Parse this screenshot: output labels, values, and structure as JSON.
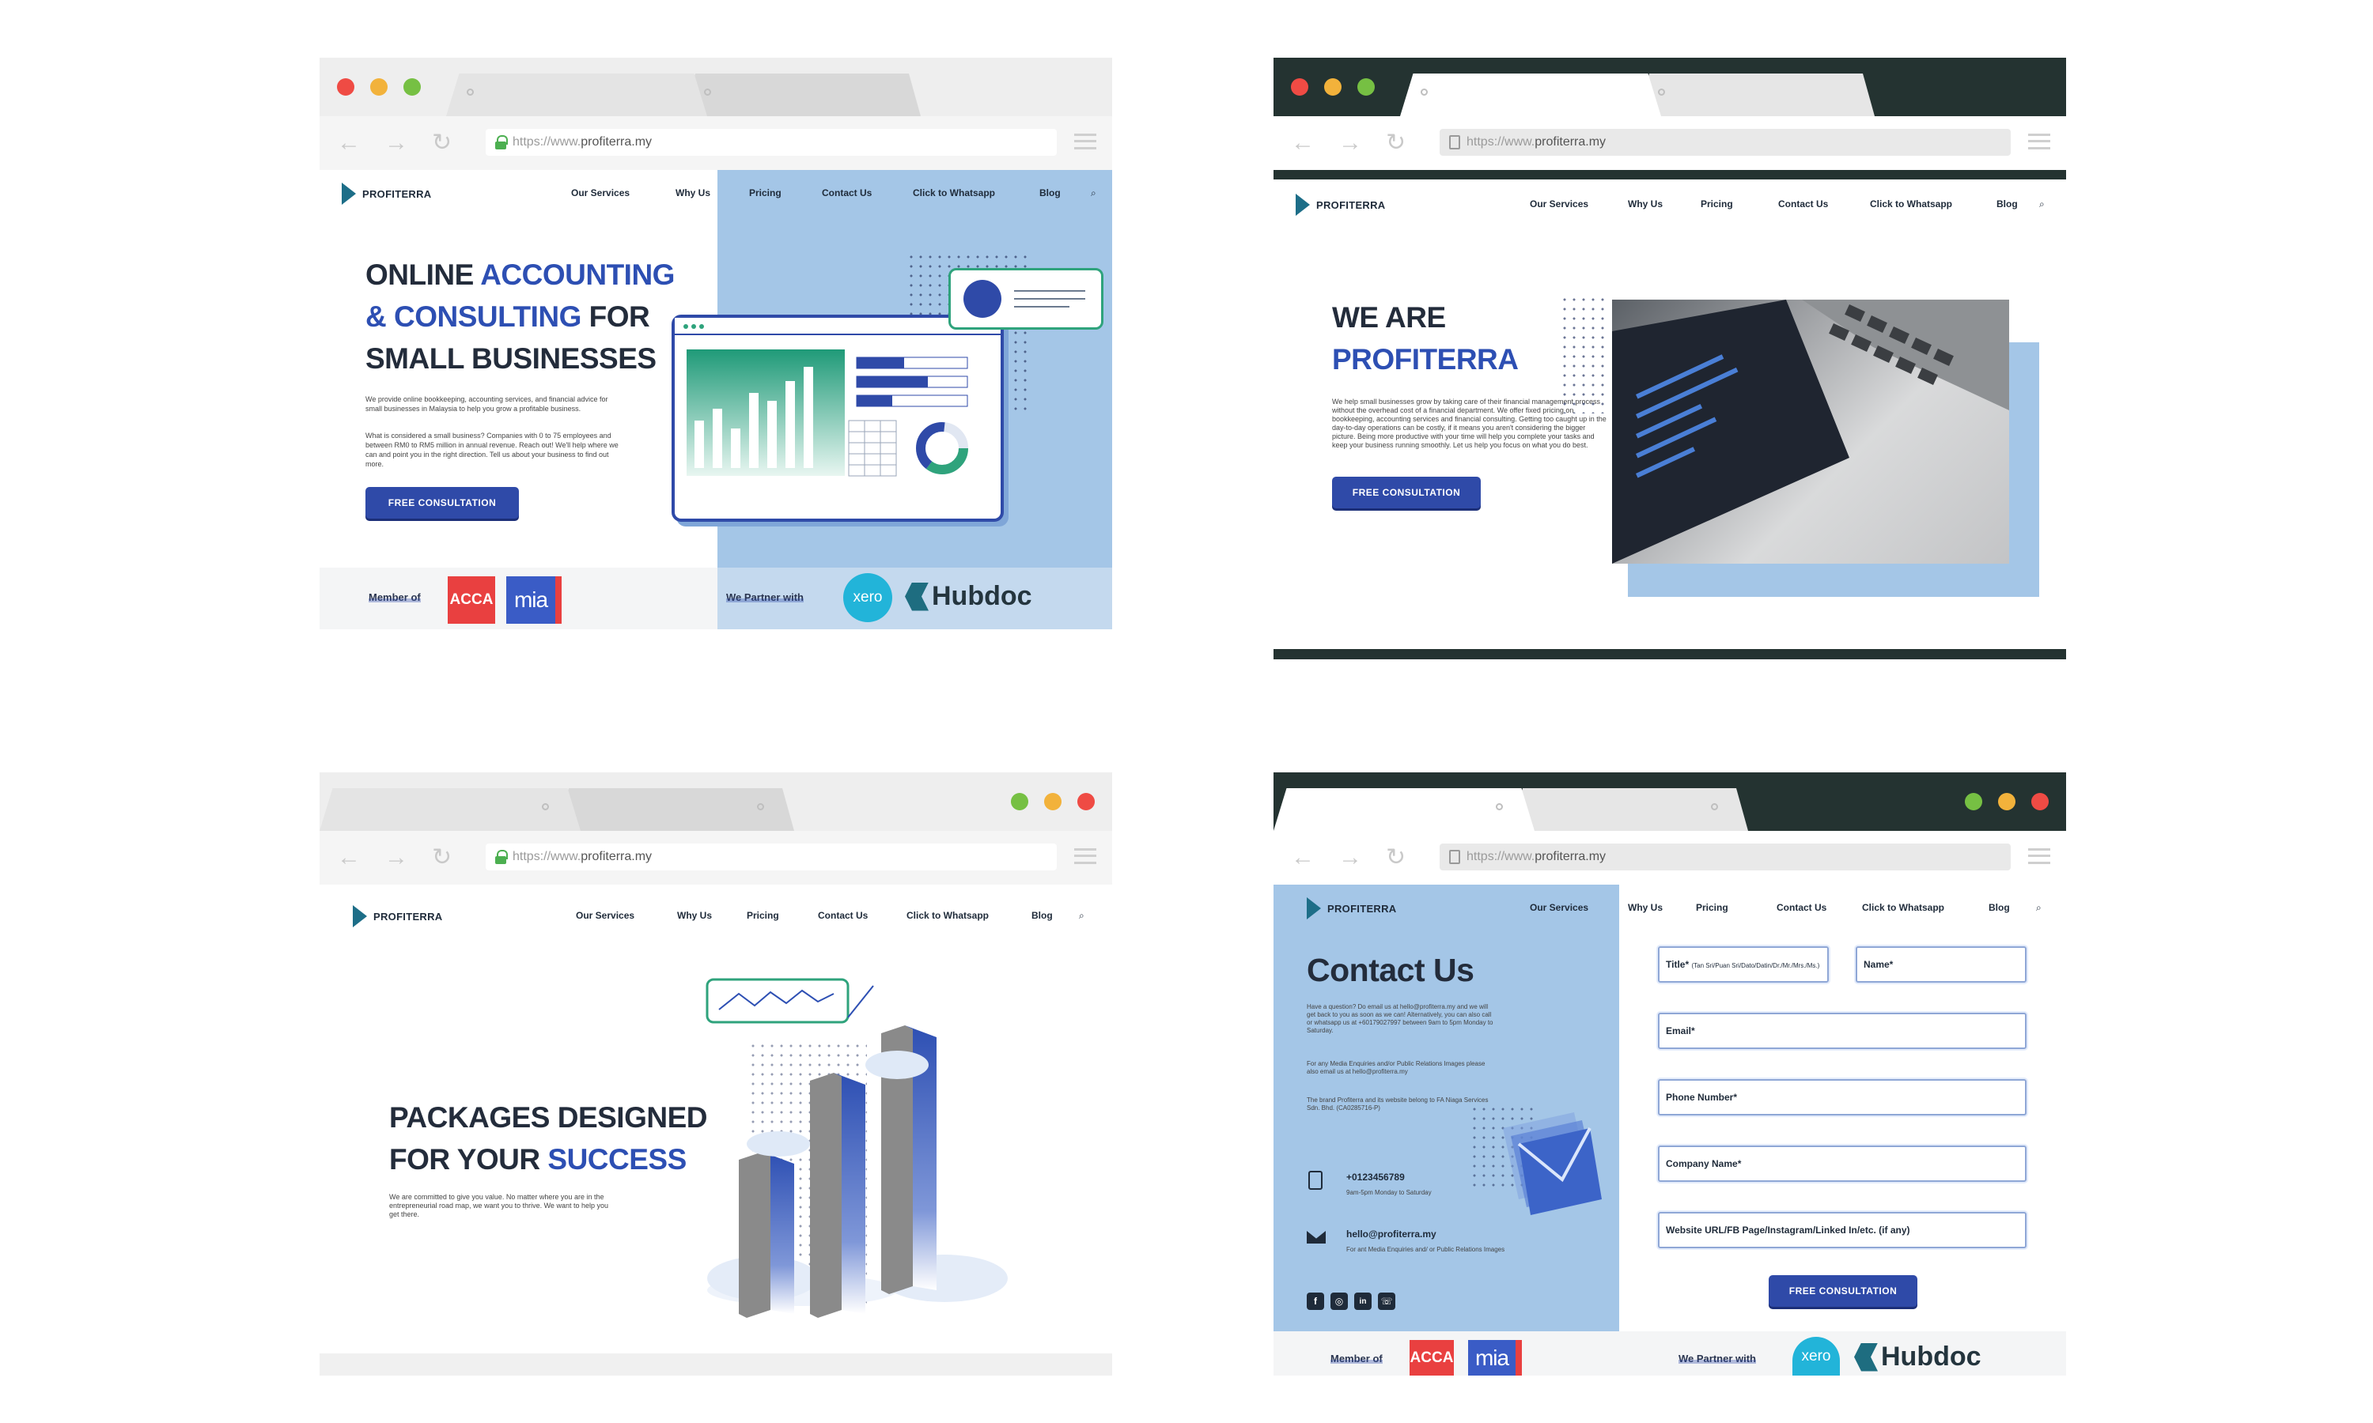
{
  "browser": {
    "url_prefix": "https://www.",
    "url_domain": "profiterra.my",
    "back": "←",
    "forward": "→",
    "reload": "↻"
  },
  "site": {
    "brand": "PROFITERRA",
    "nav": [
      "Our Services",
      "Why Us",
      "Pricing",
      "Contact Us",
      "Click to Whatsapp",
      "Blog"
    ],
    "search_glyph": "⌕",
    "cta": "FREE CONSULTATION"
  },
  "home": {
    "title_line1_a": "ONLINE ",
    "title_line1_b": "ACCOUNTING",
    "title_line2_a": "& CONSULTING",
    "title_line2_b": " FOR",
    "title_line3": "SMALL BUSINESSES",
    "para1": "We provide online bookkeeping, accounting services, and financial advice for small businesses in Malaysia to help you grow a profitable business.",
    "para2": "What is considered a small business? Companies with 0 to 75 employees and between RM0 to RM5 million in annual revenue. Reach out! We'll help where we can and point you in the right direction. Tell us about your business to find out more.",
    "member_label": "Member of",
    "partner_label": "We Partner with",
    "acca": "ACCA",
    "mia": "mia",
    "xero": "xero",
    "hubdoc": "Hubdoc"
  },
  "about": {
    "title_line1": "WE ARE",
    "title_line2": "PROFITERRA",
    "para": "We help small businesses grow by taking care of their financial management process without the overhead cost of a financial department. We offer fixed pricing on bookkeeping, accounting services and financial consulting. Getting too caught up in the day-to-day operations can be costly, if it means you aren't considering the bigger picture. Being more productive with your time will help you complete your tasks and keep your business running smoothly. Let us help you focus on what you do best."
  },
  "packages": {
    "title_line1": "PACKAGES DESIGNED",
    "title_line2_a": "FOR YOUR ",
    "title_line2_b": "SUCCESS",
    "para": "We are committed to give you value. No matter where you are in the entrepreneurial road map, we want you to thrive. We want to help you get there."
  },
  "contact": {
    "title": "Contact Us",
    "para1": "Have a question? Do email us at hello@profiterra.my and we will get back to you as soon as we can! Alternatively, you can also call or whatsapp us at +60179027997 between 9am to 5pm Monday to Saturday.",
    "para2": "For any Media Enquiries and/or Public Relations Images please also email us at hello@profiterra.my",
    "para3": "The brand Profiterra and its website belong to FA Niaga Services Sdn. Bhd. (CA0285716-P)",
    "phone": "+0123456789",
    "phone_note": "9am-5pm Monday to Saturday",
    "email": "hello@profiterra.my",
    "email_note": "For ant Media Enquiries and/ or Public Relations Images",
    "social": [
      "f",
      "◎",
      "in",
      "☏"
    ],
    "fields": {
      "title_label": "Title*",
      "title_hint": "(Tan Sri/Puan Sri/Dato/Datin/Dr./Mr./Mrs./Ms.)",
      "name": "Name*",
      "email": "Email*",
      "phone": "Phone Number*",
      "company": "Company Name*",
      "website": "Website URL/FB Page/Instagram/Linked In/etc. (if any)"
    },
    "submit": "FREE CONSULTATION"
  },
  "colors": {
    "brand_blue": "#2d4fb3",
    "light_blue_panel": "#a4c6e7",
    "dark_chrome": "#243331",
    "teal_accent": "#2fa37c"
  }
}
